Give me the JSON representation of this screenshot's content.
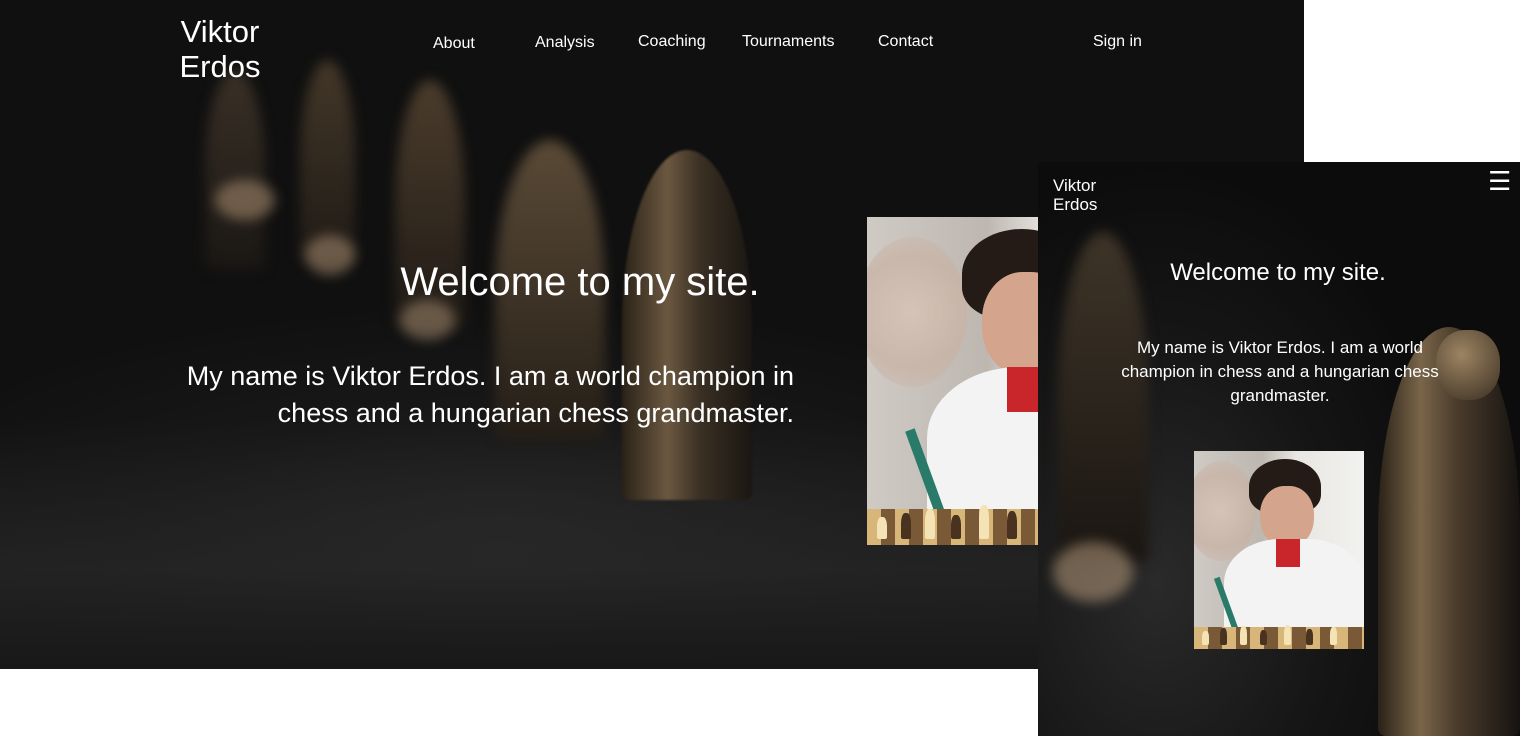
{
  "desktop": {
    "logo": "Viktor\nErdos",
    "nav": {
      "about": "About",
      "analysis": "Analysis",
      "coaching": "Coaching",
      "tournaments": "Tournaments",
      "contact": "Contact",
      "signin": "Sign in"
    },
    "hero_title": "Welcome to my site.",
    "hero_text": "My name is Viktor Erdos. I am a world champion in chess and a hungarian chess grandmaster."
  },
  "mobile": {
    "logo": "Viktor\nErdos",
    "menu_icon": "hamburger-menu-icon",
    "menu_glyph": "☰",
    "hero_title": "Welcome to my site.",
    "hero_text": "My name is Viktor Erdos. I am a world champion in chess and a hungarian chess grandmaster."
  },
  "colors": {
    "text": "#ffffff",
    "background": "#121212",
    "page": "#ffffff"
  }
}
